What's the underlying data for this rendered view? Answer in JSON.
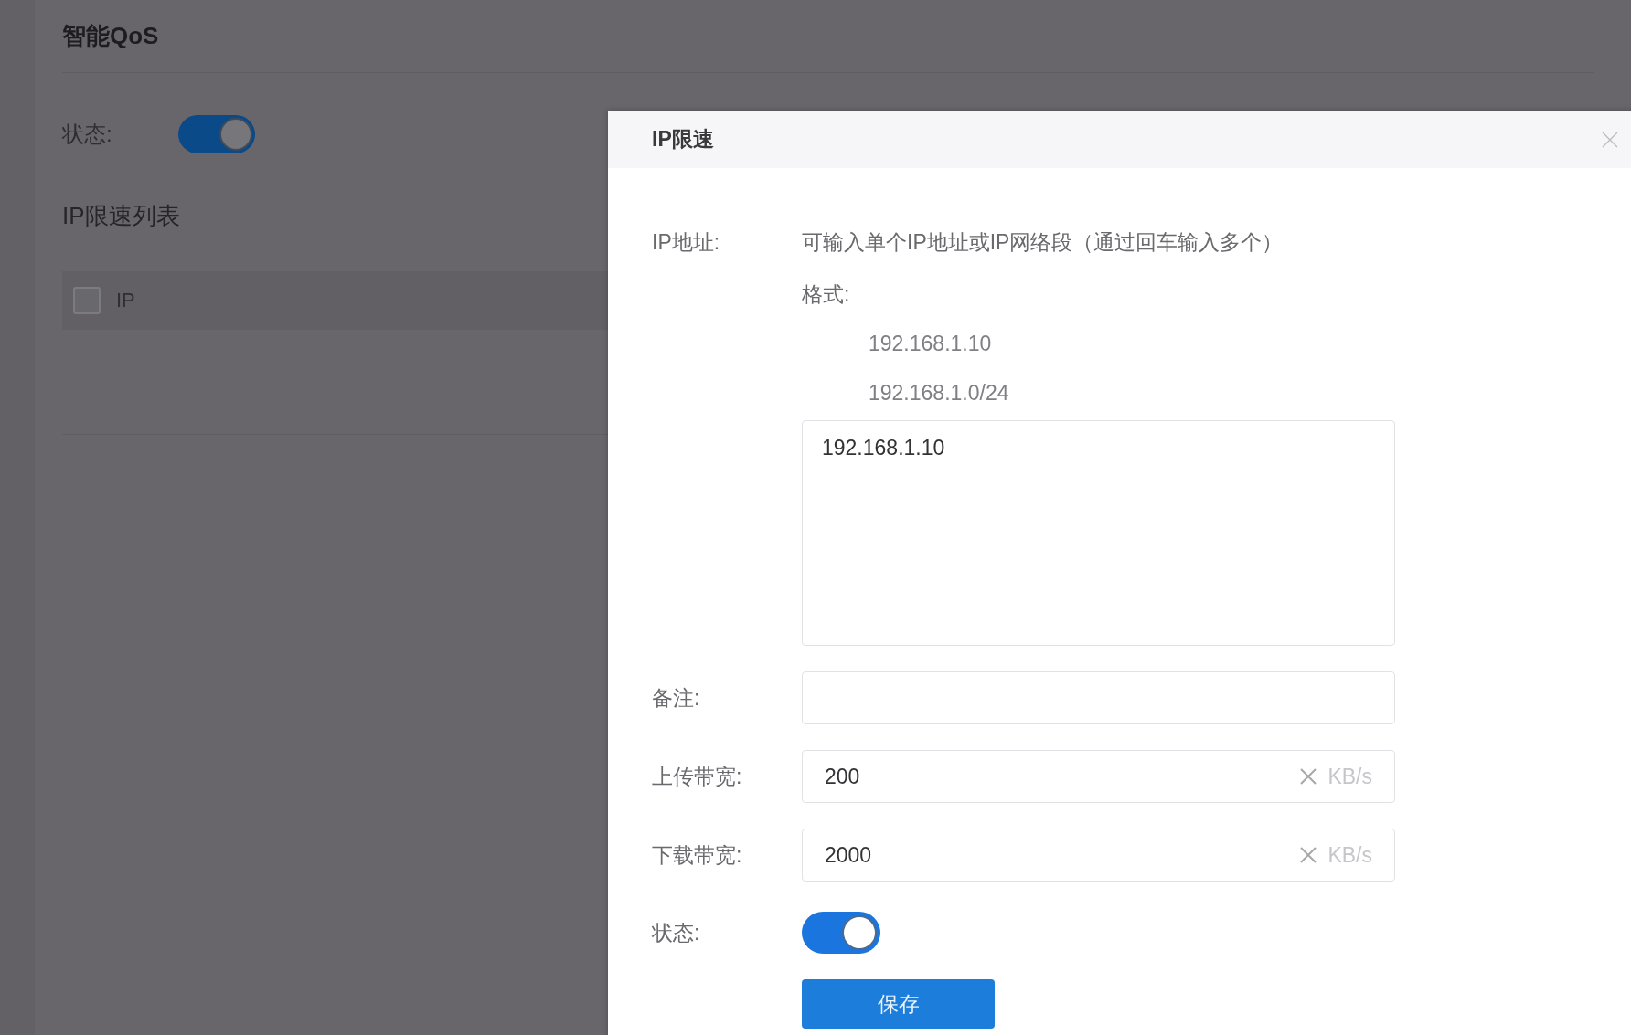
{
  "page": {
    "title": "智能QoS",
    "status": {
      "label": "状态:",
      "on": true
    },
    "list_title": "IP限速列表",
    "table": {
      "columns": [
        {
          "label": "IP",
          "checked": false
        }
      ]
    }
  },
  "dialog": {
    "title": "IP限速",
    "fields": [
      {
        "kind": "ip_list",
        "label": "IP地址:",
        "hint": "可输入单个IP地址或IP网络段（通过回车输入多个）",
        "format_label": "格式:",
        "examples": [
          "192.168.1.10",
          "192.168.1.0/24"
        ],
        "value": "192.168.1.10"
      },
      {
        "kind": "text",
        "label": "备注:"
      },
      {
        "kind": "bandwidth",
        "label": "上传带宽:",
        "value": "200",
        "unit": "KB/s"
      },
      {
        "kind": "bandwidth",
        "label": "下载带宽:",
        "value": "2000",
        "unit": "KB/s"
      },
      {
        "kind": "switch",
        "label": "状态:",
        "on": true
      }
    ],
    "save_button": "保存"
  }
}
